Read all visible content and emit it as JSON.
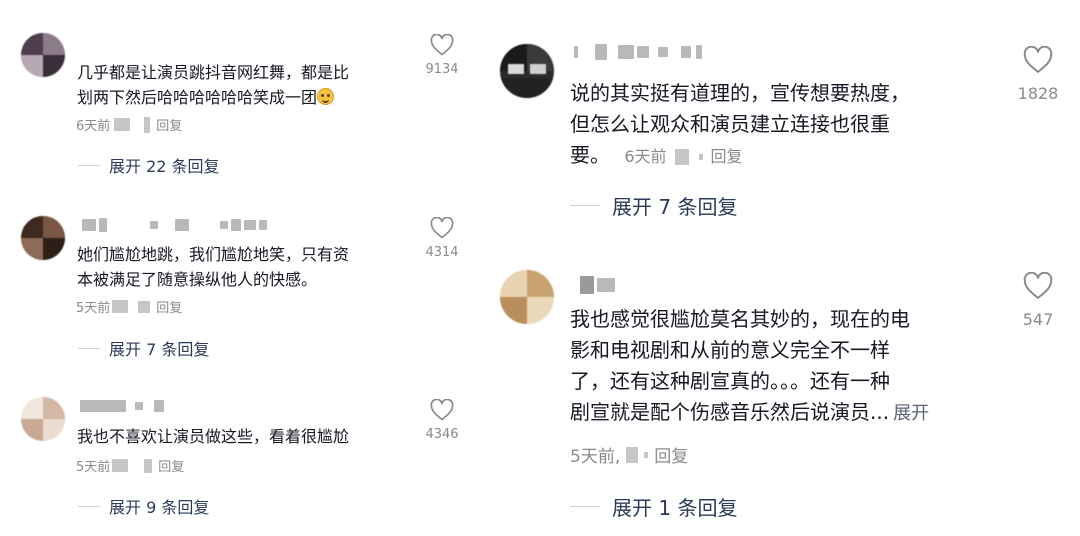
{
  "left_comments": [
    {
      "text_line1": "几乎都是让演员跳抖音网红舞，都是比",
      "text_line2": "划两下然后哈哈哈哈哈哈笑成一团",
      "emoji": "laugh-emoji",
      "time": "6天前",
      "reply": "回复",
      "expand": "展开 22 条回复",
      "likes": "9134"
    },
    {
      "text_line1": "她们尴尬地跳，我们尴尬地笑，只有资",
      "text_line2": "本被满足了随意操纵他人的快感。",
      "time": "5天前",
      "reply": "回复",
      "expand": "展开 7 条回复",
      "likes": "4314"
    },
    {
      "text_line1": "我也不喜欢让演员做这些，看着很尴尬",
      "time": "5天前",
      "reply": "回复",
      "expand": "展开 9 条回复",
      "likes": "4346"
    }
  ],
  "right_comments": [
    {
      "text_line1": "说的其实挺有道理的，宣传想要热度，",
      "text_line2": "但怎么让观众和演员建立连接也很重",
      "text_line3": "要。",
      "time": "6天前",
      "reply": "回复",
      "expand": "展开 7 条回复",
      "likes": "1828"
    },
    {
      "text_line1": "我也感觉很尴尬莫名其妙的，现在的电",
      "text_line2": "影和电视剧和从前的意义完全不一样",
      "text_line3": "了，还有这种剧宣真的。。。还有一种",
      "text_line4": "剧宣就是配个伤感音乐然后说演员...",
      "more": "展开",
      "time": "5天前,",
      "reply": "回复",
      "expand": "展开 1 条回复",
      "likes": "547"
    }
  ],
  "icons": {
    "like": "heart-outline-icon"
  },
  "colors": {
    "text": "#161823",
    "meta": "#8a8a8a",
    "expand": "#2b3a5a",
    "background": "#ffffff"
  }
}
